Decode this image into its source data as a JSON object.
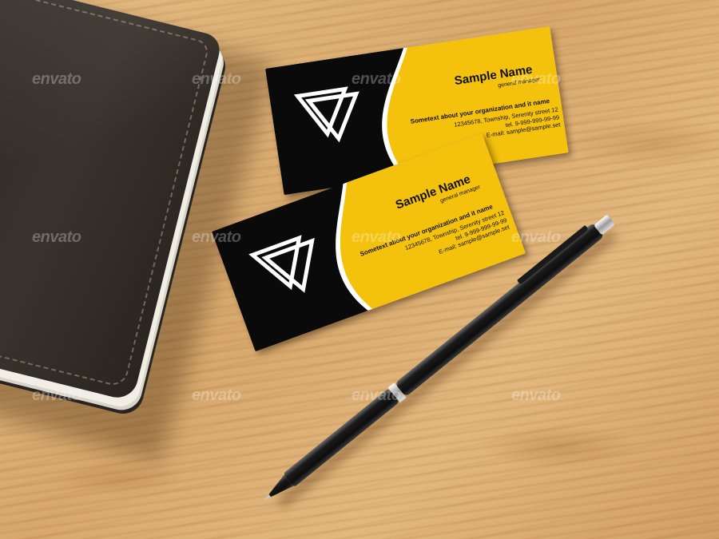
{
  "watermark": {
    "text": "envato"
  },
  "card_front": {
    "name": "Sample Name",
    "role": "general manager",
    "org": "Sometext about your organization and it name",
    "address": "12345678, Township, Serenity street 12",
    "tel": "tel. 9-999-999-99-99",
    "email": "E-mail: sample@sample.set"
  },
  "card_back": {
    "name": "Sample Name",
    "role": "general manager",
    "org": "Sometext about your organization and it name",
    "address": "12345678, Township, Serenity street 12",
    "tel": "tel. 9-999-999-99-99",
    "email": "E-mail: sample@sample.set"
  },
  "colors": {
    "card_yellow": "#f4c20d",
    "card_black": "#0a0a0a",
    "wood": "#d9a86c",
    "leather": "#332c27"
  }
}
